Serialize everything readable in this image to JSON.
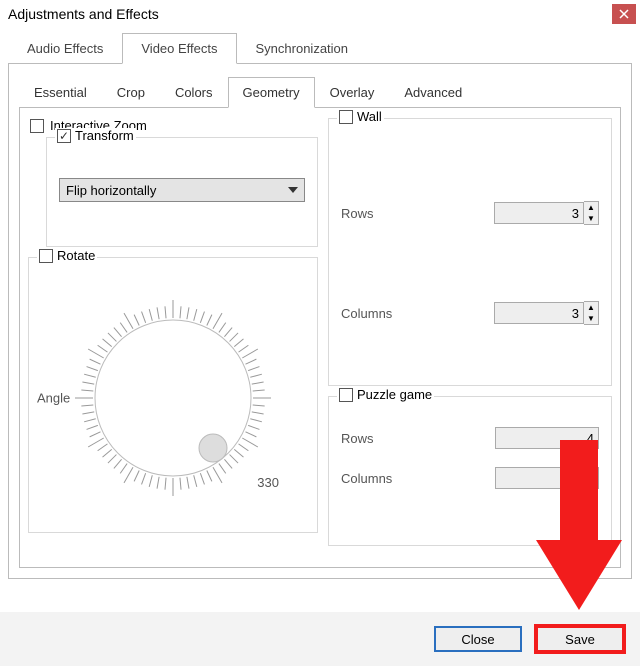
{
  "window": {
    "title": "Adjustments and Effects"
  },
  "tabs": {
    "audio": "Audio Effects",
    "video": "Video Effects",
    "sync": "Synchronization"
  },
  "inner_tabs": {
    "essential": "Essential",
    "crop": "Crop",
    "colors": "Colors",
    "geometry": "Geometry",
    "overlay": "Overlay",
    "advanced": "Advanced"
  },
  "geometry": {
    "interactive_zoom": {
      "label": "Interactive Zoom",
      "checked": false
    },
    "transform": {
      "label": "Transform",
      "checked": true,
      "value": "Flip horizontally"
    },
    "rotate": {
      "label": "Rotate",
      "checked": false,
      "angle_label": "Angle",
      "angle_num": "330"
    },
    "wall": {
      "label": "Wall",
      "checked": false,
      "rows_label": "Rows",
      "rows_value": "3",
      "cols_label": "Columns",
      "cols_value": "3"
    },
    "puzzle": {
      "label": "Puzzle game",
      "checked": false,
      "rows_label": "Rows",
      "rows_value": "4",
      "cols_label": "Columns",
      "cols_value": ""
    }
  },
  "buttons": {
    "close": "Close",
    "save": "Save"
  }
}
